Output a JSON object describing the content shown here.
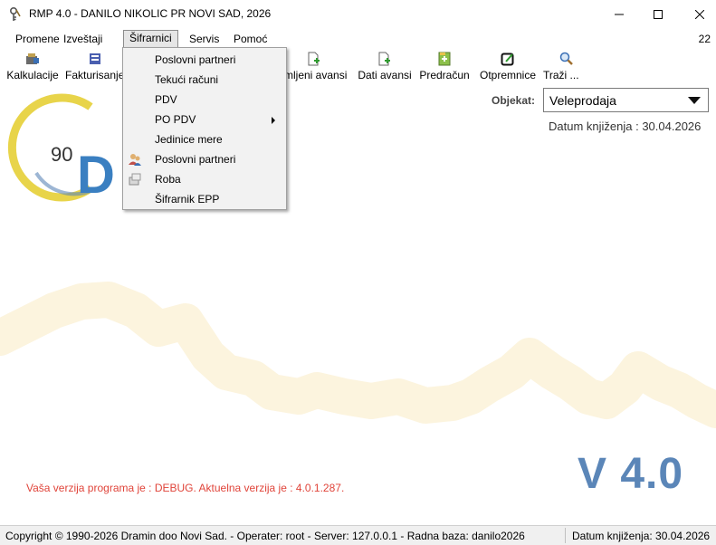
{
  "window": {
    "title": "RMP 4.0 - DANILO NIKOLIC PR NOVI SAD, 2026",
    "icon": "key-icon",
    "controls": [
      "minimize-icon",
      "maximize-icon",
      "close-icon"
    ]
  },
  "menubar": {
    "items": [
      "Promene",
      "Izveštaji",
      "Šifrarnici",
      "Servis",
      "Pomoć"
    ],
    "active": "Šifrarnici",
    "right_number": "22"
  },
  "toolbar": {
    "items": [
      {
        "label": "Kalkulacije",
        "icon": "calculator-icon"
      },
      {
        "label": "Fakturisanje",
        "icon": "invoice-icon"
      },
      {
        "label": "mljeni avansi",
        "icon": "document-add-icon"
      },
      {
        "label": "Dati avansi",
        "icon": "document-add-icon"
      },
      {
        "label": "Predračun",
        "icon": "document-green-icon"
      },
      {
        "label": "Otpremnice",
        "icon": "edit-box-icon"
      },
      {
        "label": "Traži ...",
        "icon": "magnifier-icon"
      }
    ]
  },
  "dropdown": {
    "items": [
      {
        "label": "Poslovni partneri",
        "icon": ""
      },
      {
        "label": "Tekući računi",
        "icon": ""
      },
      {
        "label": "PDV",
        "icon": ""
      },
      {
        "label": "PO PDV",
        "icon": "",
        "submenu": true
      },
      {
        "label": "Jedinice mere",
        "icon": ""
      },
      {
        "label": "Poslovni partneri",
        "icon": "partners-icon"
      },
      {
        "label": "Roba",
        "icon": "goods-icon"
      },
      {
        "label": "Šifrarnik EPP",
        "icon": ""
      }
    ]
  },
  "objekat": {
    "label": "Objekat:",
    "value": "Veleprodaja"
  },
  "datum_top": "Datum knjiženja : 30.04.2026",
  "logo_text": "90 D",
  "version": {
    "debug_text": "Vaša verzija programa je : DEBUG. Aktuelna verzija je : 4.0.1.287.",
    "big_text": "V 4.0"
  },
  "statusbar": {
    "left": "Copyright © 1990-2026 Dramin doo Novi Sad. - Operater: root - Server: 127.0.0.1 - Radna baza: danilo2026",
    "right": "Datum knjiženja: 30.04.2026"
  },
  "colors": {
    "accent_blue": "#5b86b8",
    "logo_yellow": "#e8d44a",
    "watermark": "#fcf4de",
    "debug_red": "#e0443a"
  }
}
